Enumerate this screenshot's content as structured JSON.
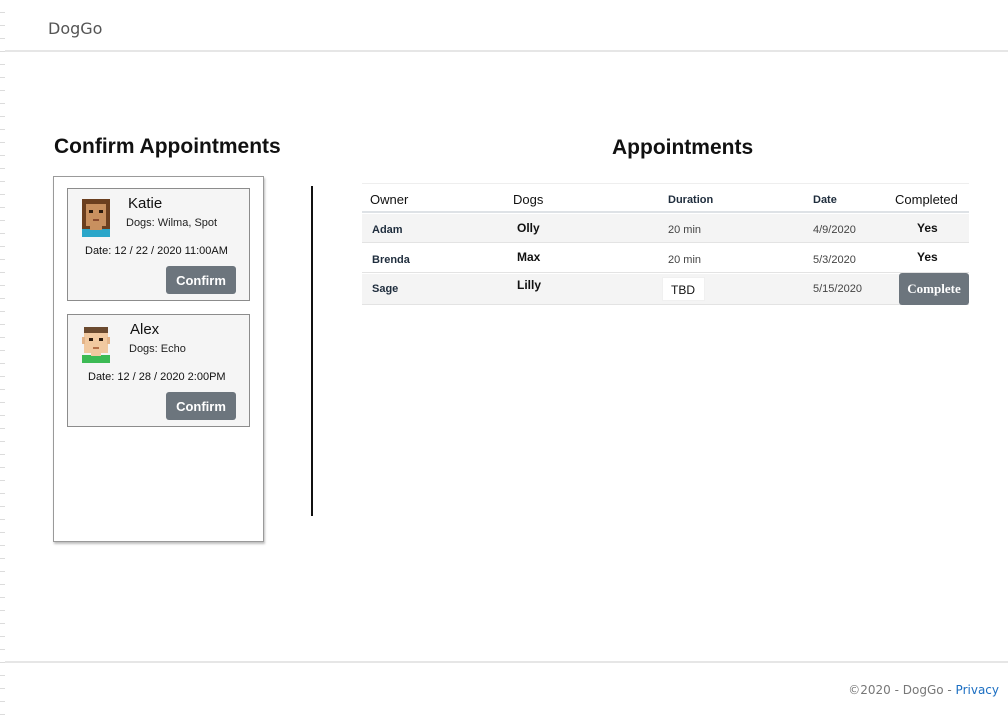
{
  "app": {
    "brand": "DogGo"
  },
  "confirm_section": {
    "title": "Confirm Appointments",
    "cards": [
      {
        "owner": "Katie",
        "dogs": "Dogs: Wilma, Spot",
        "date": "Date: 12 / 22 / 2020 11:00AM",
        "button_label": "Confirm",
        "avatar_icon": "avatar-woman-icon"
      },
      {
        "owner": "Alex",
        "dogs": "Dogs: Echo",
        "date": "Date: 12 / 28 / 2020 2:00PM",
        "button_label": "Confirm",
        "avatar_icon": "avatar-man-icon"
      }
    ]
  },
  "appointments": {
    "title": "Appointments",
    "columns": [
      "Owner",
      "Dogs",
      "Duration",
      "Date",
      "Completed"
    ],
    "rows": [
      {
        "owner": "Adam",
        "dog": "Olly",
        "duration": "20 min",
        "date": "4/9/2020",
        "completed": "Yes"
      },
      {
        "owner": "Brenda",
        "dog": "Max",
        "duration": "20 min",
        "date": "5/3/2020",
        "completed": "Yes"
      },
      {
        "owner": "Sage",
        "dog": "Lilly",
        "duration": "TBD",
        "date": "5/15/2020",
        "completed": "Complete"
      }
    ]
  },
  "footer": {
    "copyright": "©2020 - DogGo - ",
    "privacy": "Privacy"
  },
  "colors": {
    "button_gray": "#6c757d",
    "link_blue": "#1b6ec2"
  }
}
